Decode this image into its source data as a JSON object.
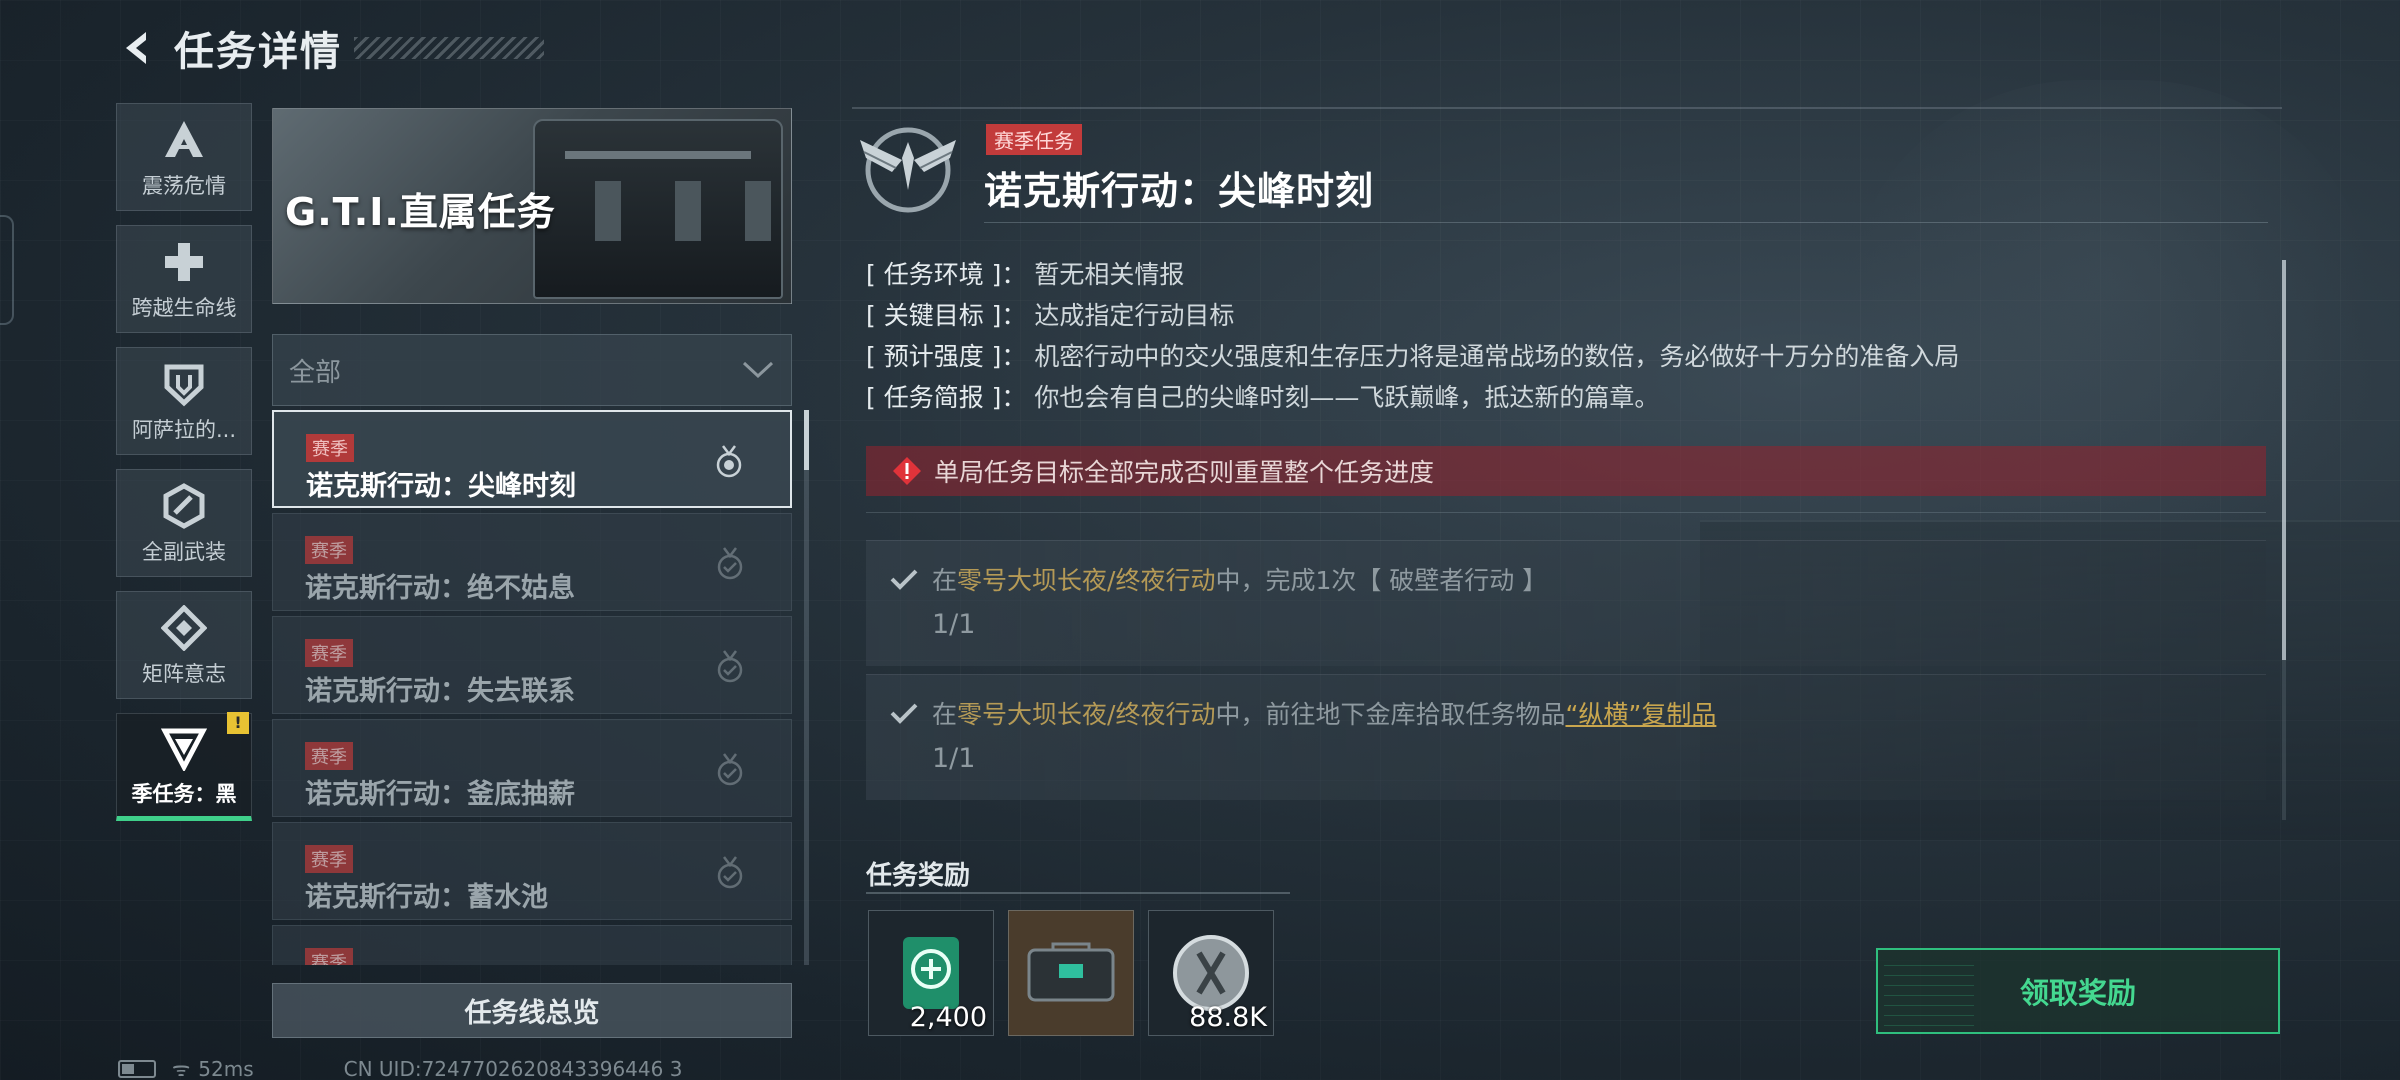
{
  "header": {
    "title": "任务详情"
  },
  "categories": [
    {
      "label": "震荡危情",
      "icon": "delta-a-icon"
    },
    {
      "label": "跨越生命线",
      "icon": "medical-cross-icon"
    },
    {
      "label": "阿萨拉的...",
      "icon": "shield-emblem-icon"
    },
    {
      "label": "全副武装",
      "icon": "armor-hex-icon"
    },
    {
      "label": "矩阵意志",
      "icon": "matrix-diamond-icon"
    },
    {
      "label": "季任务：黑",
      "icon": "season-triangle-icon",
      "badge": "!"
    }
  ],
  "banner": {
    "text": "G.T.I.直属任务"
  },
  "filter": {
    "value": "全部"
  },
  "quests": [
    {
      "tag": "赛季",
      "name": "诺克斯行动：尖峰时刻"
    },
    {
      "tag": "赛季",
      "name": "诺克斯行动：绝不姑息"
    },
    {
      "tag": "赛季",
      "name": "诺克斯行动：失去联系"
    },
    {
      "tag": "赛季",
      "name": "诺克斯行动：釜底抽薪"
    },
    {
      "tag": "赛季",
      "name": "诺克斯行动：蓄水池"
    },
    {
      "tag": "赛季",
      "name": ""
    }
  ],
  "overview_button": "任务线总览",
  "status_bar": {
    "ping": "52ms",
    "uid": "CN UID:7247702620843396446 3"
  },
  "detail": {
    "tag": "赛季任务",
    "title": "诺克斯行动：尖峰时刻",
    "info": [
      {
        "key": "[ 任务环境 ]：",
        "value": "暂无相关情报"
      },
      {
        "key": "[ 关键目标 ]：",
        "value": "达成指定行动目标"
      },
      {
        "key": "[ 预计强度 ]：",
        "value": "机密行动中的交火强度和生存压力将是通常战场的数倍，务必做好十万分的准备入局"
      },
      {
        "key": "[ 任务简报 ]：",
        "value": "你也会有自己的尖峰时刻——飞跃巅峰，抵达新的篇章。"
      }
    ],
    "warning": "单局任务目标全部完成否则重置整个任务进度",
    "objectives": [
      {
        "pre": "在",
        "map": "零号大坝长夜/终夜行动",
        "mid": "中，完成1次【 破壁者行动 】",
        "link": "",
        "progress": "1/1"
      },
      {
        "pre": "在",
        "map": "零号大坝长夜/终夜行动",
        "mid": "中，前往地下金库拾取任务物品",
        "link": "“纵横”复制品",
        "progress": "1/1"
      }
    ]
  },
  "rewards": {
    "title": "任务奖励",
    "items": [
      {
        "icon": "green-currency-icon",
        "amount": "2,400"
      },
      {
        "icon": "supply-case-icon",
        "amount": ""
      },
      {
        "icon": "silver-coin-icon",
        "amount": "88.8K"
      }
    ]
  },
  "claim_button": "领取奖励",
  "colors": {
    "accent_green": "#3fd08a",
    "season_red": "#c23b3b",
    "map_gold": "#b59a56"
  }
}
